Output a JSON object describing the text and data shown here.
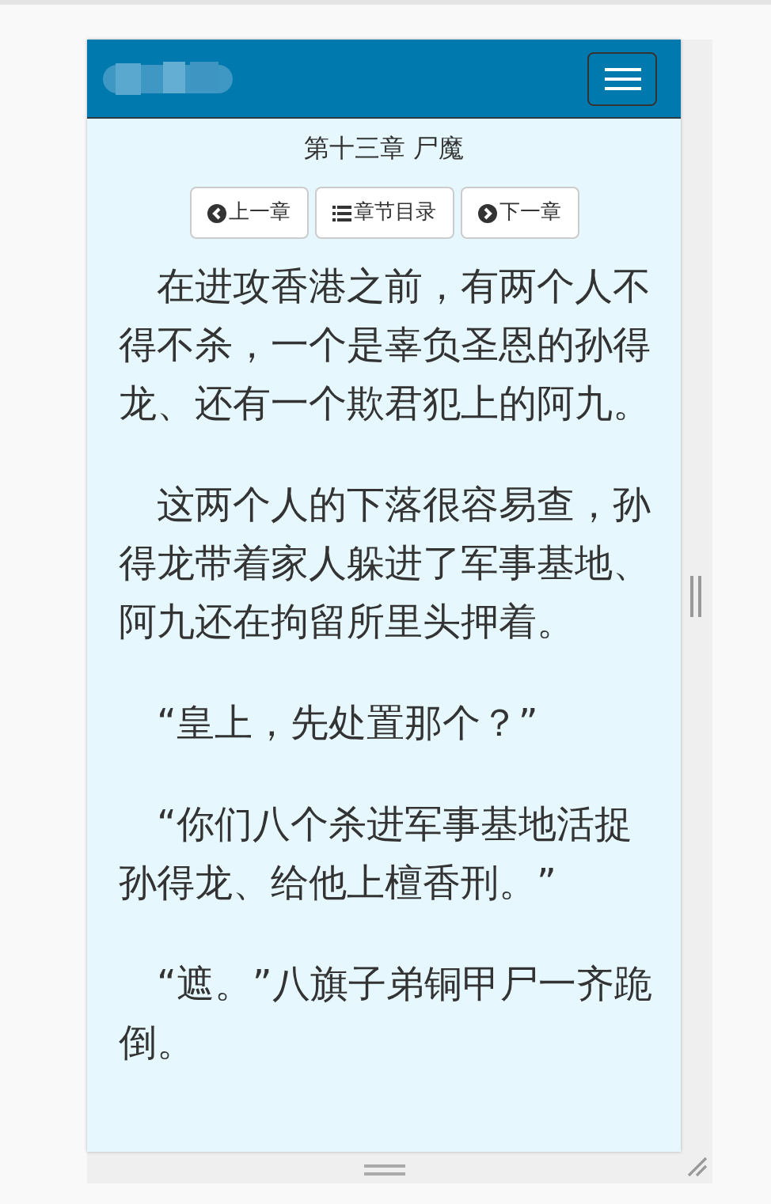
{
  "navbar": {
    "menu_button": {
      "expanded": false
    }
  },
  "chapter_title": "第十三章 尸魔",
  "chapter_nav": [
    {
      "kind": "prev",
      "label": "上一章"
    },
    {
      "kind": "toc",
      "label": "章节目录"
    },
    {
      "kind": "next",
      "label": "下一章"
    }
  ],
  "paragraphs": [
    "在进攻香港之前，有两个人不得不杀，一个是辜负圣恩的孙得龙、还有一个欺君犯上的阿九。",
    "这两个人的下落很容易查，孙得龙带着家人躲进了军事基地、阿九还在拘留所里头押着。",
    "“皇上，先处置那个？”",
    "“你们八个杀进军事基地活捉孙得龙、给他上檀香刑。”",
    "“遮。”八旗子弟铜甲尸一齐跪倒。"
  ]
}
